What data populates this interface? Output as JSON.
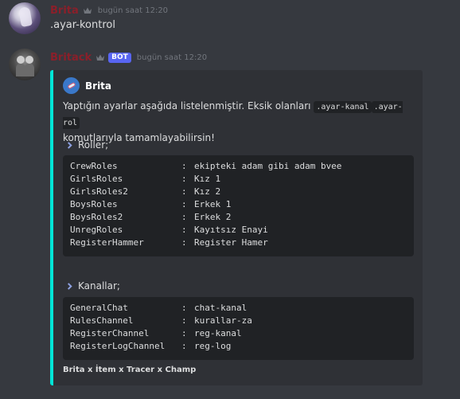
{
  "colors": {
    "background": "#36393f",
    "embed_bg": "#2f3136",
    "embed_accent": "#00e5d6",
    "username": "#8b1f2a",
    "bot_tag": "#5865f2",
    "code_bg": "#202225"
  },
  "messages": [
    {
      "username": "Brita",
      "timestamp": "bugün saat 12:20",
      "content": ".ayar-kontrol"
    },
    {
      "username": "Britack",
      "bot_tag": "BOT",
      "timestamp": "bugün saat 12:20"
    }
  ],
  "embed": {
    "author": "Brita",
    "desc_part1": "Yaptığın ayarlar aşağıda listelenmiştir. Eksik olanları",
    "code1": ".ayar-kanal",
    "code2": ".ayar-rol",
    "desc_part2": "komutlarıyla tamamlayabilirsin!",
    "roles_title": "Roller;",
    "roles": [
      {
        "key": "CrewRoles",
        "value": "ekipteki adam gibi adam bvee"
      },
      {
        "key": "GirlsRoles",
        "value": "Kız 1"
      },
      {
        "key": "GirlsRoles2",
        "value": "Kız 2"
      },
      {
        "key": "BoysRoles",
        "value": "Erkek 1"
      },
      {
        "key": "BoysRoles2",
        "value": "Erkek 2"
      },
      {
        "key": "UnregRoles",
        "value": "Kayıtsız Enayi"
      },
      {
        "key": "RegisterHammer",
        "value": "Register Hamer"
      }
    ],
    "channels_title": "Kanallar;",
    "channels": [
      {
        "key": "GeneralChat",
        "value": "chat-kanal"
      },
      {
        "key": "RulesChannel",
        "value": "kurallar-za"
      },
      {
        "key": "RegisterChannel",
        "value": "reg-kanal"
      },
      {
        "key": "RegisterLogChannel",
        "value": "reg-log"
      }
    ],
    "separator": ":",
    "footer": "Brita x İtem x Tracer x Champ"
  }
}
